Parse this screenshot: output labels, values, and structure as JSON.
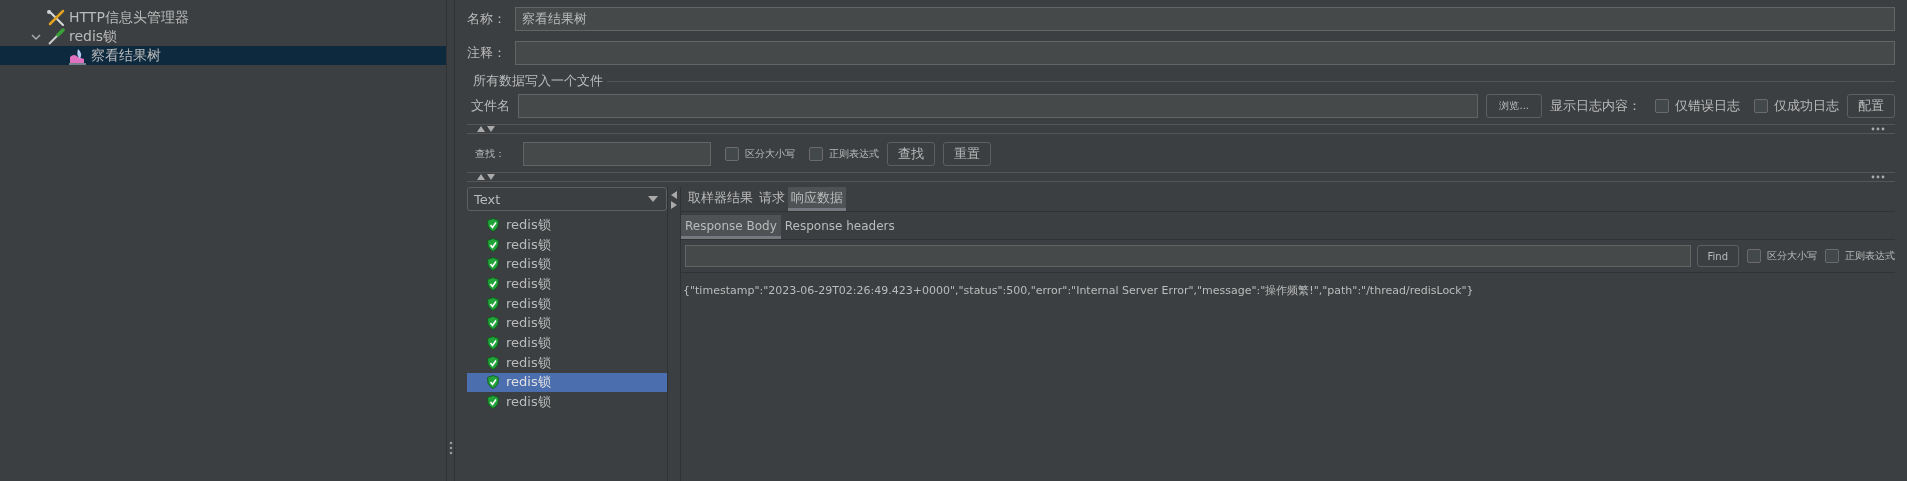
{
  "tree": {
    "items": [
      {
        "label": "HTTP信息头管理器",
        "kind": "config",
        "selected": false
      },
      {
        "label": "redis锁",
        "kind": "sampler",
        "selected": false,
        "expanded": true,
        "children": [
          {
            "label": "察看结果树",
            "kind": "listener",
            "selected": true
          }
        ]
      }
    ]
  },
  "form": {
    "name_label": "名称：",
    "name_value": "察看结果树",
    "comment_label": "注释：",
    "file_group": {
      "title": "所有数据写入一个文件",
      "file_label": "文件名",
      "browse_button": "浏览...",
      "log_label": "显示日志内容：",
      "checkboxes": [
        {
          "label": "仅错误日志",
          "checked": false
        },
        {
          "label": "仅成功日志",
          "checked": false
        }
      ],
      "config_button": "配置"
    }
  },
  "search": {
    "label": "查找：",
    "checkboxes": [
      {
        "label": "区分大小写",
        "checked": false
      },
      {
        "label": "正则表达式",
        "checked": false
      }
    ],
    "buttons": [
      "查找",
      "重置"
    ]
  },
  "results": {
    "renderer": "Text",
    "samples": [
      {
        "label": "redis锁",
        "kind": "success",
        "selected": false
      },
      {
        "label": "redis锁",
        "kind": "success",
        "selected": false
      },
      {
        "label": "redis锁",
        "kind": "success",
        "selected": false
      },
      {
        "label": "redis锁",
        "kind": "success",
        "selected": false
      },
      {
        "label": "redis锁",
        "kind": "success",
        "selected": false
      },
      {
        "label": "redis锁",
        "kind": "success",
        "selected": false
      },
      {
        "label": "redis锁",
        "kind": "success",
        "selected": false
      },
      {
        "label": "redis锁",
        "kind": "success",
        "selected": false
      },
      {
        "label": "redis锁",
        "kind": "success",
        "selected": true
      },
      {
        "label": "redis锁",
        "kind": "success",
        "selected": false
      }
    ],
    "tabs": [
      {
        "label": "取样器结果",
        "selected": false
      },
      {
        "label": "请求",
        "selected": false
      },
      {
        "label": "响应数据",
        "selected": true
      }
    ],
    "subtabs": [
      {
        "label": "Response Body",
        "selected": true
      },
      {
        "label": "Response headers",
        "selected": false
      }
    ],
    "find_button": "Find",
    "checkboxes": [
      {
        "label": "区分大小写",
        "checked": false
      },
      {
        "label": "正则表达式",
        "checked": false
      }
    ],
    "body": "{\"timestamp\":\"2023-06-29T02:26:49.423+0000\",\"status\":500,\"error\":\"Internal Server Error\",\"message\":\"操作频繁!\",\"path\":\"/thread/redisLock\"}"
  }
}
